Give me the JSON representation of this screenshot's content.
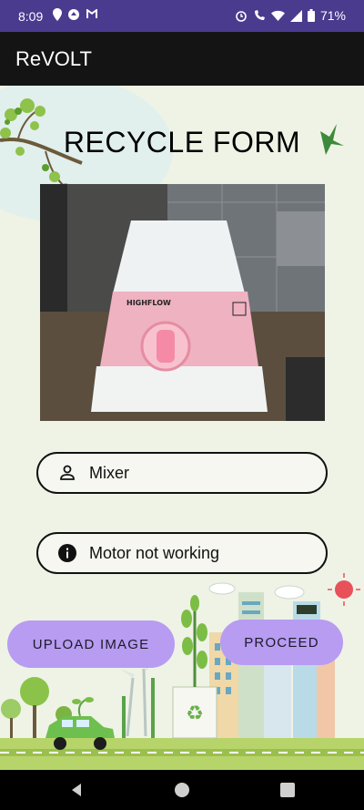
{
  "status_bar": {
    "time": "8:09",
    "battery": "71%"
  },
  "app_bar": {
    "title": "ReVOLT"
  },
  "form": {
    "title": "RECYCLE FORM",
    "item_name": "Mixer",
    "issue": "Motor not working",
    "brand_on_photo": "HIGHFLOW"
  },
  "buttons": {
    "upload": "UPLOAD IMAGE",
    "proceed": "PROCEED"
  }
}
